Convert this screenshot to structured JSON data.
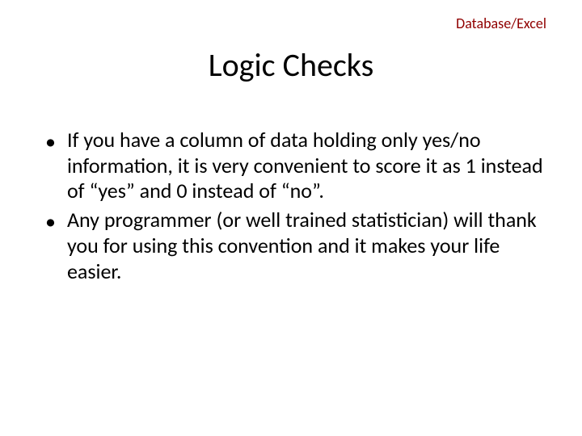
{
  "corner_label": "Database/Excel",
  "title": "Logic Checks",
  "bullets": [
    "If you have a column of data holding only yes/no information, it is very convenient to score it as 1 instead of “yes” and 0 instead of “no”.",
    "Any programmer (or well trained statistician) will thank you for using this convention and it makes your life easier."
  ]
}
